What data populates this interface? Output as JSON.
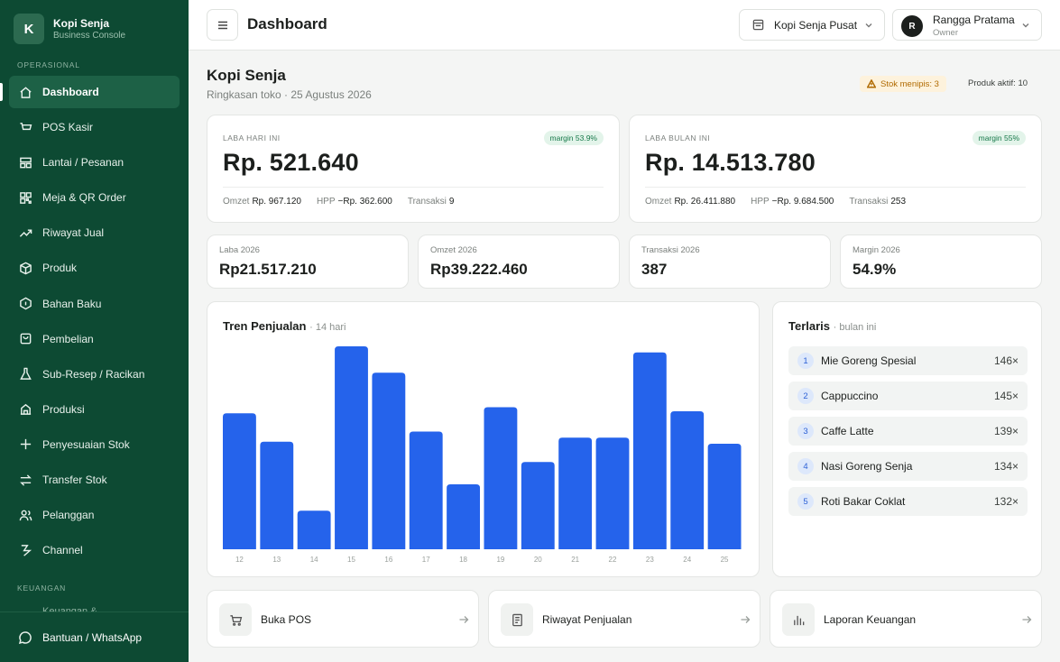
{
  "brand": {
    "logo_letter": "K",
    "name": "Kopi Senja",
    "subtitle": "Business Console"
  },
  "sidebar": {
    "section_operasional": "OPERASIONAL",
    "items": [
      {
        "label": "Dashboard",
        "icon": "home-icon",
        "active": true
      },
      {
        "label": "POS Kasir",
        "icon": "cart-icon"
      },
      {
        "label": "Lantai / Pesanan",
        "icon": "layout-icon"
      },
      {
        "label": "Meja & QR Order",
        "icon": "qr-icon"
      },
      {
        "label": "Riwayat Jual",
        "icon": "trend-icon"
      },
      {
        "label": "Produk",
        "icon": "box-icon"
      },
      {
        "label": "Bahan Baku",
        "icon": "hexagon-icon"
      },
      {
        "label": "Pembelian",
        "icon": "shopping-bag-icon"
      },
      {
        "label": "Sub-Resep / Racikan",
        "icon": "flask-icon"
      },
      {
        "label": "Produksi",
        "icon": "factory-icon"
      },
      {
        "label": "Penyesuaian Stok",
        "icon": "plus-icon"
      },
      {
        "label": "Transfer Stok",
        "icon": "transfer-icon"
      },
      {
        "label": "Pelanggan",
        "icon": "users-icon"
      },
      {
        "label": "Channel",
        "icon": "channel-icon"
      }
    ],
    "section_keuangan": "KEUANGAN",
    "cut_item": "Keuangan &",
    "help_label": "Bantuan / WhatsApp"
  },
  "topbar": {
    "title": "Dashboard",
    "store": "Kopi Senja Pusat",
    "user_initial": "R",
    "user_name": "Rangga Pratama",
    "user_role": "Owner"
  },
  "main": {
    "title": "Kopi Senja",
    "subtitle": "Ringkasan toko · 25 Agustus 2026",
    "warning_badge": "Stok menipis: 3",
    "active_products": "Produk aktif: 10"
  },
  "profit_today": {
    "label": "LABA HARI INI",
    "margin": "margin 53.9%",
    "value": "Rp. 521.640",
    "omzet_label": "Omzet",
    "omzet": "Rp. 967.120",
    "hpp_label": "HPP",
    "hpp": "−Rp. 362.600",
    "trx_label": "Transaksi",
    "trx": "9"
  },
  "profit_month": {
    "label": "LABA BULAN INI",
    "margin": "margin 55%",
    "value": "Rp. 14.513.780",
    "omzet_label": "Omzet",
    "omzet": "Rp. 26.411.880",
    "hpp_label": "HPP",
    "hpp": "−Rp. 9.684.500",
    "trx_label": "Transaksi",
    "trx": "253"
  },
  "yearly": [
    {
      "label": "Laba 2026",
      "value": "Rp21.517.210"
    },
    {
      "label": "Omzet 2026",
      "value": "Rp39.222.460"
    },
    {
      "label": "Transaksi 2026",
      "value": "387"
    },
    {
      "label": "Margin 2026",
      "value": "54.9%"
    }
  ],
  "trend": {
    "title": "Tren Penjualan",
    "subtitle": "· 14 hari",
    "bar_color": "#2563eb"
  },
  "chart_data": {
    "type": "bar",
    "categories": [
      "12",
      "13",
      "14",
      "15",
      "16",
      "17",
      "18",
      "19",
      "20",
      "21",
      "22",
      "23",
      "24",
      "25"
    ],
    "values": [
      67,
      53,
      19,
      100,
      87,
      58,
      32,
      70,
      43,
      55,
      55,
      97,
      68,
      52
    ],
    "ylim": [
      0,
      100
    ],
    "grid": false,
    "legend": "none"
  },
  "top_list": {
    "title": "Terlaris",
    "subtitle": "· bulan ini",
    "items": [
      {
        "rank": "1",
        "name": "Mie Goreng Spesial",
        "count": "146×"
      },
      {
        "rank": "2",
        "name": "Cappuccino",
        "count": "145×"
      },
      {
        "rank": "3",
        "name": "Caffe Latte",
        "count": "139×"
      },
      {
        "rank": "4",
        "name": "Nasi Goreng Senja",
        "count": "134×"
      },
      {
        "rank": "5",
        "name": "Roti Bakar Coklat",
        "count": "132×"
      }
    ]
  },
  "actions": [
    {
      "label": "Buka POS",
      "icon": "cart-icon"
    },
    {
      "label": "Riwayat Penjualan",
      "icon": "document-icon"
    },
    {
      "label": "Laporan Keuangan",
      "icon": "bar-chart-icon"
    }
  ],
  "colors": {
    "sidebar_bg": "#0d4a33",
    "accent": "#2563eb",
    "success": "#17794a",
    "warning": "#b06a00"
  }
}
